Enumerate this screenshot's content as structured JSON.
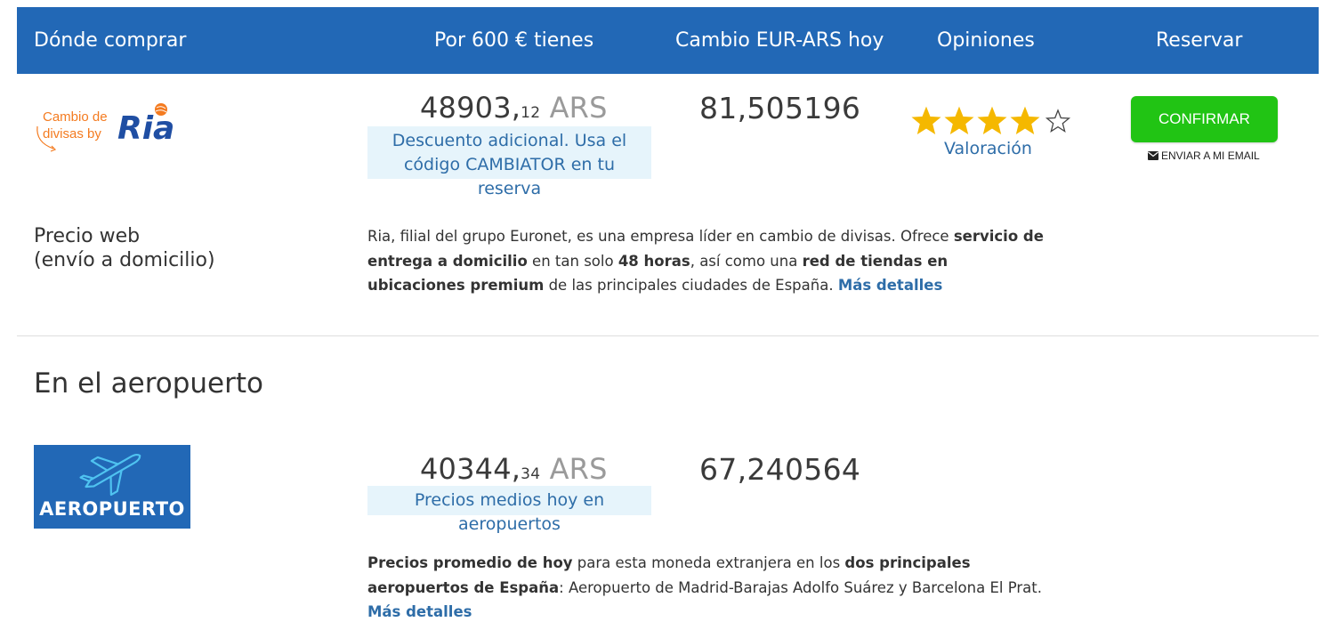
{
  "header": {
    "where": "Dónde comprar",
    "por": "Por 600 € tienes",
    "cambio": "Cambio EUR-ARS hoy",
    "opiniones": "Opiniones",
    "reservar": "Reservar"
  },
  "ria": {
    "logo_text_1": "Cambio de",
    "logo_text_2": "divisas by",
    "logo_brand": "Ria",
    "amount_int": "48903,",
    "amount_dec": "12",
    "amount_cur": " ARS",
    "promo": "Descuento adicional. Usa el código CAMBIATOR en tu reserva",
    "rate": "81,505196",
    "rating_stars": 4,
    "rating_max": 5,
    "rating_label": "Valoración",
    "confirm_label": "CONFIRMAR",
    "email_label": "ENVIAR A MI EMAIL",
    "web_label_1": "Precio web",
    "web_label_2": "(envío a domicilio)",
    "desc_1": "Ria, filial del grupo Euronet, es una empresa líder en cambio de divisas. Ofrece ",
    "desc_b1": "servicio de entrega a domicilio",
    "desc_2": " en tan solo ",
    "desc_b2": "48 horas",
    "desc_3": ", así como una ",
    "desc_b3": "red de tiendas en ubicaciones premium",
    "desc_4": " de las principales ciudades de España. ",
    "desc_link": "Más detalles"
  },
  "airport": {
    "section_title": "En el aeropuerto",
    "logo_label": "AEROPUERTO",
    "amount_int": "40344,",
    "amount_dec": "34",
    "amount_cur": " ARS",
    "promo": "Precios medios hoy en aeropuertos",
    "rate": "67,240564",
    "desc_b1": "Precios promedio de hoy",
    "desc_1": " para esta moneda extranjera en los ",
    "desc_b2": "dos principales aeropuertos de España",
    "desc_2": ": Aeropuerto de Madrid-Barajas Adolfo Suárez y Barcelona El Prat. ",
    "desc_link": "Más detalles"
  },
  "colors": {
    "header_bg": "#2268b6",
    "confirm_green": "#21c414",
    "link_blue": "#2e6da8",
    "promo_bg": "#e6f4fb",
    "star_gold": "#f5b800",
    "ria_orange": "#f47b20",
    "ria_blue": "#1f4ea3"
  }
}
